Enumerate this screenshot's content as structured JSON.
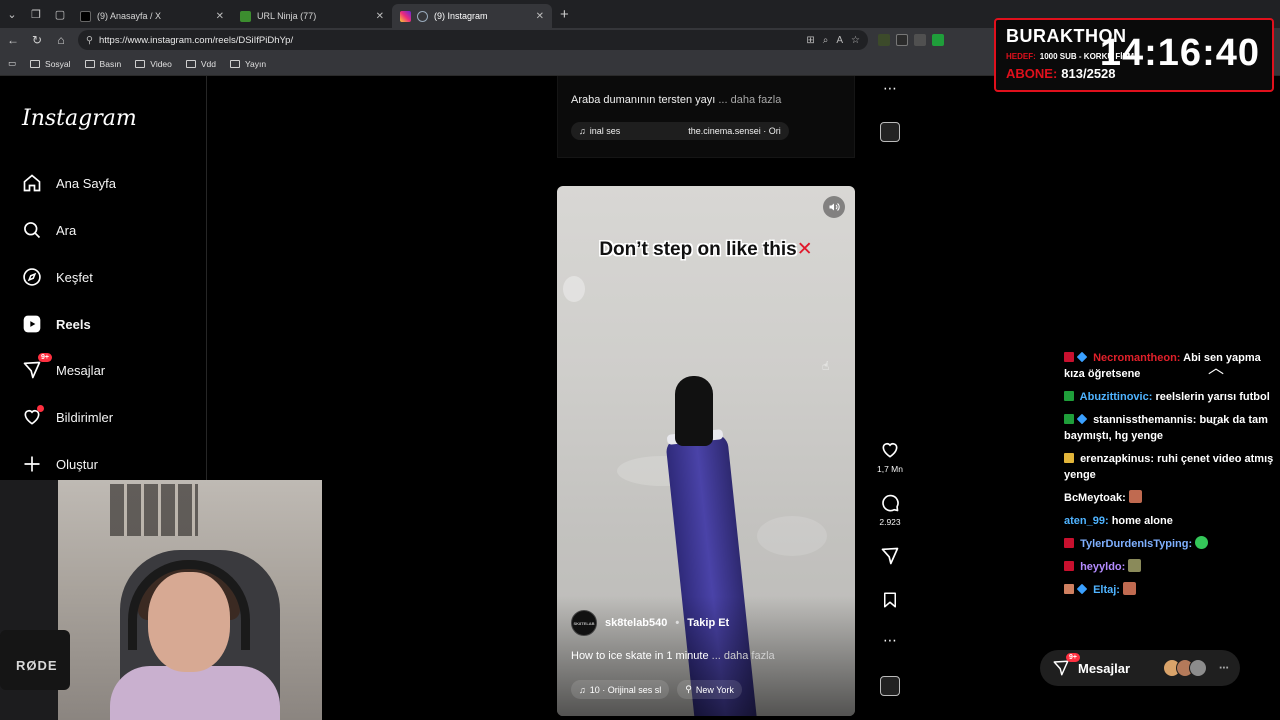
{
  "browser": {
    "tabs": [
      {
        "title": "(9) Anasayfa / X",
        "favicon": "x-logo-icon",
        "active": false
      },
      {
        "title": "URL Ninja (77)",
        "favicon": "ninja-icon",
        "active": false
      },
      {
        "title": "(9) Instagram",
        "favicon": "instagram-icon",
        "active": true
      }
    ],
    "url": "https://www.instagram.com/reels/DSiIfPiDhYp/",
    "bookmarks": [
      "Sosyal",
      "Basın",
      "Video",
      "Vdd",
      "Yayın"
    ]
  },
  "sidebar": {
    "logo": "Instagram",
    "items": [
      {
        "label": "Ana Sayfa",
        "icon": "home-icon"
      },
      {
        "label": "Ara",
        "icon": "search-icon"
      },
      {
        "label": "Keşfet",
        "icon": "compass-icon"
      },
      {
        "label": "Reels",
        "icon": "reels-icon",
        "active": true
      },
      {
        "label": "Mesajlar",
        "icon": "messenger-icon",
        "badge": "9+"
      },
      {
        "label": "Bildirimler",
        "icon": "heart-icon"
      },
      {
        "label": "Oluştur",
        "icon": "plus-icon"
      }
    ]
  },
  "webcam": {
    "mic_brand": "RØDE"
  },
  "previous_reel": {
    "caption": "Araba dumanının tersten yayı",
    "more": "... daha fazla",
    "audio": "inal ses",
    "audio_author": "the.cinema.sensei · Ori"
  },
  "reel": {
    "overlay_text": "Don’t step on like this",
    "overlay_mark": "✕",
    "author": "sk8telab540",
    "author_separator": "•",
    "follow": "Takip Et",
    "caption": "How to ice skate in 1 minute",
    "more": "... daha fazla",
    "audio": "10 · Orijinal ses  sl",
    "location": "New York",
    "avatar_text": "SK8TELAB"
  },
  "actions": {
    "likes": "1,7 Mn",
    "comments": "2.923"
  },
  "stream_overlay": {
    "title": "BURAKTHON",
    "goal_key": "HEDEF:",
    "goal_value": "1000 SUB - KORKU FİLMİ",
    "subs_key": "ABONE:",
    "subs_value": "813/2528",
    "timer": "14:16:40"
  },
  "chat": [
    {
      "user": "Necromantheon:",
      "text": "Abi sen yapma kıza öğretsene",
      "color": "#e0202a"
    },
    {
      "user": "Abuzittinovic:",
      "text": "reelslerin yarısı futbol",
      "color": "#4fb3ff"
    },
    {
      "user": "stannissthemannis:",
      "text": "burak da tam baymıştı, hg yenge",
      "color": "#e8e8e8"
    },
    {
      "user": "erenzapkinus:",
      "text": "ruhi çenet video atmış yenge",
      "color": "#e8e8e8"
    },
    {
      "user": "BcMeytoak:",
      "text": "",
      "color": "#e8e8e8"
    },
    {
      "user": "aten_99:",
      "text": "home alone",
      "color": "#4fb3ff"
    },
    {
      "user": "TylerDurdenIsTyping:",
      "text": "",
      "color": "#7fb0ff"
    },
    {
      "user": "heyyldo:",
      "text": "",
      "color": "#b48cff"
    },
    {
      "user": "Eltaj:",
      "text": "",
      "color": "#4fb3ff"
    }
  ],
  "messages_pill": {
    "label": "Mesajlar",
    "badge": "9+"
  }
}
